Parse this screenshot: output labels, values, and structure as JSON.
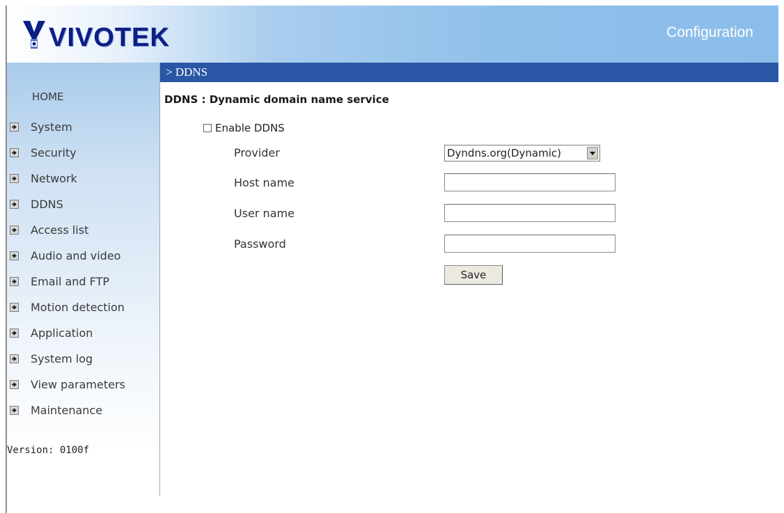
{
  "header": {
    "logo_text": "VIVOTEK",
    "title": "Configuration"
  },
  "sidebar": {
    "home_label": "HOME",
    "items": [
      {
        "label": "System"
      },
      {
        "label": "Security"
      },
      {
        "label": "Network"
      },
      {
        "label": "DDNS"
      },
      {
        "label": "Access list"
      },
      {
        "label": "Audio and video"
      },
      {
        "label": "Email and FTP"
      },
      {
        "label": "Motion detection"
      },
      {
        "label": "Application"
      },
      {
        "label": "System log"
      },
      {
        "label": "View parameters"
      },
      {
        "label": "Maintenance"
      }
    ],
    "version": "Version: 0100f"
  },
  "section": {
    "breadcrumb": "> DDNS",
    "title": "DDNS : Dynamic domain name service"
  },
  "form": {
    "enable_label": "Enable DDNS",
    "enable_checked": false,
    "provider_label": "Provider",
    "provider_value": "Dyndns.org(Dynamic)",
    "hostname_label": "Host name",
    "hostname_value": "",
    "username_label": "User name",
    "username_value": "",
    "password_label": "Password",
    "password_value": "",
    "save_label": "Save"
  },
  "colors": {
    "brand_navy": "#0b1f86",
    "section_bar": "#2a56a6",
    "header_blue": "#8abde9"
  },
  "icons": {
    "nav_item": "arrow-right-icon",
    "select": "chevron-down-icon",
    "logo": "vivotek-camera-logo"
  }
}
